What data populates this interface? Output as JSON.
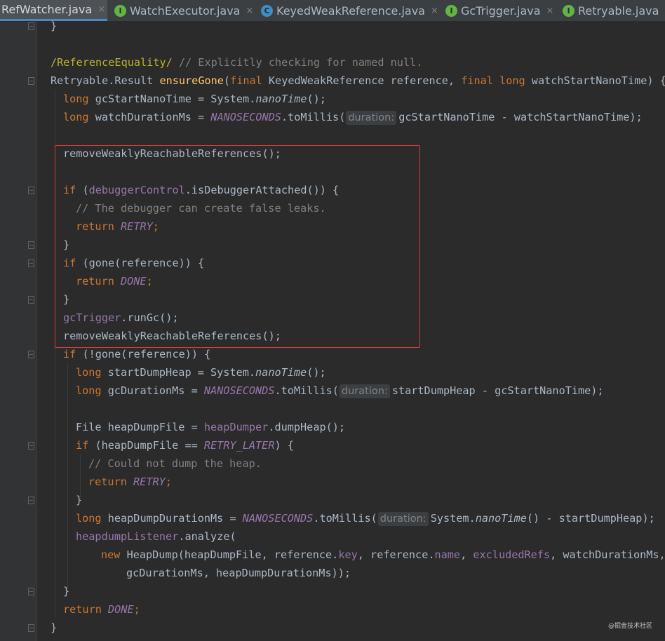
{
  "tabs": [
    {
      "label": "RefWatcher.java",
      "icon": "none",
      "active": true
    },
    {
      "label": "WatchExecutor.java",
      "icon": "interface-icon"
    },
    {
      "label": "KeyedWeakReference.java",
      "icon": "class-icon"
    },
    {
      "label": "GcTrigger.java",
      "icon": "interface-icon"
    },
    {
      "label": "Retryable.java",
      "icon": "interface-icon"
    }
  ],
  "close_glyph": "×",
  "code": {
    "l0": "}",
    "l1_ann": "/ReferenceEquality/",
    "l1_cmt": " // Explicitly checking for named null.",
    "l2_a": "Retryable.Result ",
    "l2_fn": "ensureGone",
    "l2_b": "(",
    "l2_kw1": "final",
    "l2_c": " KeyedWeakReference reference, ",
    "l2_kw2": "final long",
    "l2_d": " watchStartNanoTime) {",
    "l3_kw": "long",
    "l3_a": " gcStartNanoTime = System.",
    "l3_it": "nanoTime",
    "l3_b": "();",
    "l4_kw": "long",
    "l4_a": " watchDurationMs = ",
    "l4_f": "NANOSECONDS",
    "l4_b": ".toMillis(",
    "l4_hint": "duration:",
    "l4_c": "gcStartNanoTime - watchStartNanoTime);",
    "l6": "removeWeaklyReachableReferences();",
    "l8_kw": "if",
    "l8_a": " (",
    "l8_f": "debuggerControl",
    "l8_b": ".isDebuggerAttached()) {",
    "l9_cmt": "// The debugger can create false leaks.",
    "l10_kw": "return",
    "l10_f": "RETRY",
    "l10_b": ";",
    "l11": "}",
    "l12_kw": "if",
    "l12_a": " (gone(reference)) {",
    "l13_kw": "return",
    "l13_f": "DONE",
    "l13_b": ";",
    "l14": "}",
    "l15_f": "gcTrigger",
    "l15_a": ".runGc();",
    "l16": "removeWeaklyReachableReferences();",
    "l17_kw": "if",
    "l17_a": " (!gone(reference)) {",
    "l18_kw": "long",
    "l18_a": " startDumpHeap = System.",
    "l18_it": "nanoTime",
    "l18_b": "();",
    "l19_kw": "long",
    "l19_a": " gcDurationMs = ",
    "l19_f": "NANOSECONDS",
    "l19_b": ".toMillis(",
    "l19_hint": "duration:",
    "l19_c": "startDumpHeap - gcStartNanoTime);",
    "l21_a": "File heapDumpFile = ",
    "l21_f": "heapDumper",
    "l21_b": ".dumpHeap();",
    "l22_kw": "if",
    "l22_a": " (heapDumpFile == ",
    "l22_f": "RETRY_LATER",
    "l22_b": ") {",
    "l23_cmt": "// Could not dump the heap.",
    "l24_kw": "return",
    "l24_f": "RETRY",
    "l24_b": ";",
    "l25": "}",
    "l26_kw": "long",
    "l26_a": " heapDumpDurationMs = ",
    "l26_f": "NANOSECONDS",
    "l26_b": ".toMillis(",
    "l26_hint": "duration:",
    "l26_c": "System.",
    "l26_it": "nanoTime",
    "l26_d": "() - startDumpHeap);",
    "l27_f": "heapdumpListener",
    "l27_a": ".analyze(",
    "l28_kw": "new",
    "l28_a": " HeapDump(heapDumpFile, reference.",
    "l28_f1": "key",
    "l28_b": ", reference.",
    "l28_f2": "name",
    "l28_c": ", ",
    "l28_f3": "excludedRefs",
    "l28_d": ", watchDurationMs,",
    "l29": "gcDurationMs, heapDumpDurationMs));",
    "l30": "}",
    "l31_kw": "return",
    "l31_f": "DONE",
    "l31_b": ";",
    "l32": "}"
  },
  "watermark": "@掘金技术社区",
  "colors": {
    "background": "#2b2b2b",
    "keyword": "#cc7832",
    "method": "#ffc66d",
    "field": "#9876aa",
    "comment": "#808080",
    "highlight_box": "#d23c3c"
  }
}
